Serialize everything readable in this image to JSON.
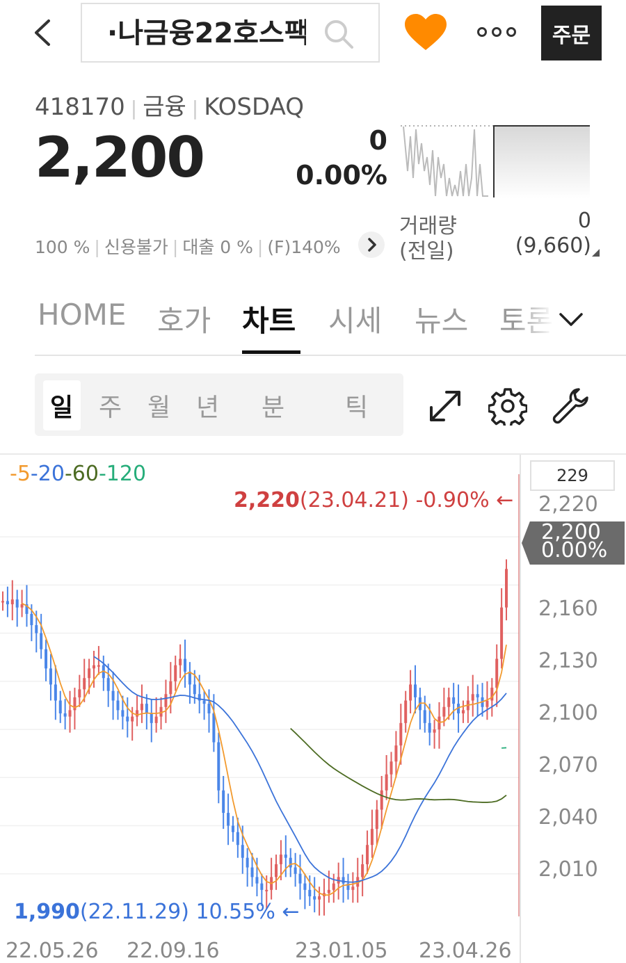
{
  "header": {
    "search_text": "·나금융22호스팩",
    "order_label": "주문",
    "icons": [
      "back-chevron-icon",
      "search-icon",
      "heart-icon",
      "more-dots-icon"
    ],
    "heart_color": "#ff8a00"
  },
  "stock": {
    "code": "418170",
    "sector": "금융",
    "market": "KOSDAQ",
    "price": "2,200",
    "change": "0",
    "change_pct": "0.00%",
    "volume_label": "거래량",
    "prev_label": "(전일)",
    "volume": "0",
    "prev_volume": "(9,660)",
    "sub_info": {
      "margin": "100 %",
      "credit": "신용불가",
      "loan": "대출 0 %",
      "foreign": "(F)140%"
    }
  },
  "tabs": [
    {
      "label": "HOME"
    },
    {
      "label": "호가"
    },
    {
      "label": "차트"
    },
    {
      "label": "시세"
    },
    {
      "label": "뉴스"
    },
    {
      "label": "토론"
    }
  ],
  "active_tab": "차트",
  "periods": [
    {
      "label": "일"
    },
    {
      "label": "주"
    },
    {
      "label": "월"
    },
    {
      "label": "년"
    },
    {
      "label": "분"
    },
    {
      "label": "틱"
    }
  ],
  "active_period": "일",
  "tools": [
    "expand-icon",
    "gear-icon",
    "wrench-icon"
  ],
  "chart_data": {
    "type": "candlestick",
    "moving_averages": [
      {
        "name": "5",
        "color": "#f29a2e"
      },
      {
        "name": "20",
        "color": "#3b73d9"
      },
      {
        "name": "60",
        "color": "#4c6b22"
      },
      {
        "name": "120",
        "color": "#26ad7a"
      }
    ],
    "ma_sep": "-",
    "high": {
      "value": "2,220",
      "date": "(23.04.21)",
      "pct": "-0.90%"
    },
    "low": {
      "value": "1,990",
      "date": "(22.11.29)",
      "pct": "10.55%"
    },
    "arrow": "←",
    "current": {
      "price": "2,200",
      "pct": "0.00%"
    },
    "volume_box": "229",
    "y_ticks": [
      "2,220",
      "2,160",
      "2,130",
      "2,100",
      "2,070",
      "2,040",
      "2,010"
    ],
    "x_ticks": [
      "22.05.26",
      "22.09.16",
      "23.01.05",
      "23.04.26"
    ],
    "ylim": [
      1980,
      2240
    ],
    "up_color": "#e06060",
    "down_color": "#4a86e8",
    "close_series": [
      2180,
      2178,
      2181,
      2176,
      2178,
      2172,
      2165,
      2160,
      2150,
      2138,
      2128,
      2118,
      2110,
      2108,
      2112,
      2120,
      2125,
      2132,
      2138,
      2140,
      2140,
      2132,
      2124,
      2118,
      2112,
      2108,
      2105,
      2108,
      2112,
      2116,
      2110,
      2104,
      2108,
      2114,
      2122,
      2130,
      2140,
      2144,
      2136,
      2128,
      2122,
      2118,
      2116,
      2110,
      2092,
      2062,
      2048,
      2040,
      2036,
      2028,
      2020,
      2014,
      2008,
      2004,
      2000,
      2000,
      2008,
      2016,
      2022,
      2020,
      2014,
      2010,
      2004,
      2000,
      1996,
      1994,
      1996,
      1998,
      2000,
      2004,
      2008,
      2004,
      2000,
      2002,
      2008,
      2016,
      2028,
      2038,
      2050,
      2062,
      2072,
      2080,
      2090,
      2104,
      2118,
      2128,
      2120,
      2112,
      2104,
      2098,
      2100,
      2108,
      2114,
      2120,
      2116,
      2110,
      2112,
      2118,
      2122,
      2120,
      2114,
      2118,
      2126,
      2144,
      2176,
      2200
    ]
  }
}
